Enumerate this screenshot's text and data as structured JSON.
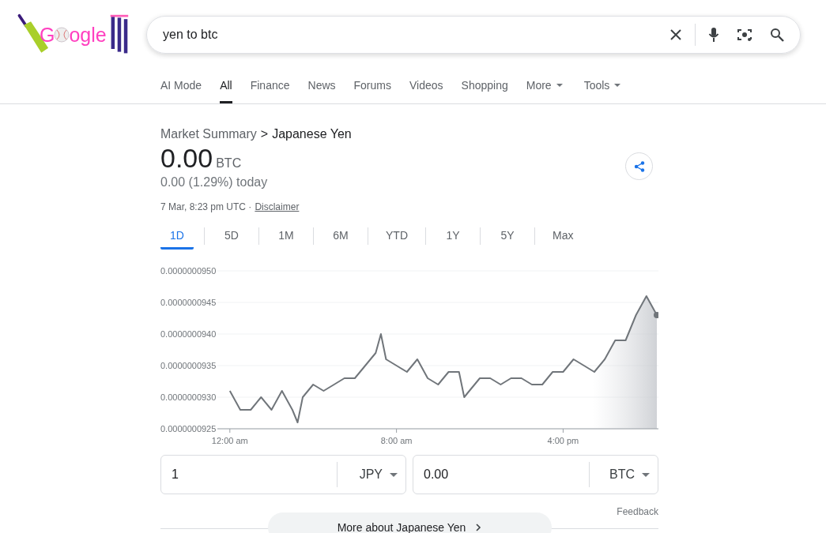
{
  "logo": {
    "lead": "G",
    "tail": "ogle"
  },
  "search": {
    "value": "yen to btc"
  },
  "tabs": [
    {
      "label": "AI Mode",
      "selected": false,
      "dropdown": false
    },
    {
      "label": "All",
      "selected": true,
      "dropdown": false
    },
    {
      "label": "Finance",
      "selected": false,
      "dropdown": false
    },
    {
      "label": "News",
      "selected": false,
      "dropdown": false
    },
    {
      "label": "Forums",
      "selected": false,
      "dropdown": false
    },
    {
      "label": "Videos",
      "selected": false,
      "dropdown": false
    },
    {
      "label": "Shopping",
      "selected": false,
      "dropdown": false
    },
    {
      "label": "More",
      "selected": false,
      "dropdown": true
    },
    {
      "label": "Tools",
      "selected": false,
      "dropdown": true
    }
  ],
  "summary": {
    "breadcrumb_root": "Market Summary",
    "breadcrumb_sep": ">",
    "breadcrumb_current": "Japanese Yen",
    "price": "0.00",
    "currency": "BTC",
    "change": "0.00 (1.29%) today",
    "timestamp": "7 Mar, 8:23 pm UTC ·",
    "disclaimer": "Disclaimer"
  },
  "ranges": [
    {
      "label": "1D",
      "selected": true
    },
    {
      "label": "5D",
      "selected": false
    },
    {
      "label": "1M",
      "selected": false
    },
    {
      "label": "6M",
      "selected": false
    },
    {
      "label": "YTD",
      "selected": false
    },
    {
      "label": "1Y",
      "selected": false
    },
    {
      "label": "5Y",
      "selected": false
    },
    {
      "label": "Max",
      "selected": false
    }
  ],
  "chart_data": {
    "type": "area",
    "grid": true,
    "xlim": [
      -0.6,
      20.5
    ],
    "x": [
      0,
      0.5,
      1,
      1.5,
      2,
      2.5,
      3,
      3.25,
      3.5,
      4,
      4.5,
      5,
      5.5,
      6,
      6.5,
      7,
      7.25,
      7.5,
      8,
      8.5,
      9,
      9.5,
      10,
      10.5,
      11,
      11.25,
      11.5,
      12,
      12.5,
      13,
      13.5,
      14,
      14.5,
      15,
      15.5,
      16,
      16.5,
      17,
      17.5,
      18,
      18.5,
      19,
      19.5,
      20,
      20.5
    ],
    "series": [
      {
        "color": "#70757a",
        "values": [
          9.31e-08,
          9.28e-08,
          9.28e-08,
          9.3e-08,
          9.28e-08,
          9.31e-08,
          9.28e-08,
          9.26e-08,
          9.3e-08,
          9.32e-08,
          9.31e-08,
          9.32e-08,
          9.33e-08,
          9.33e-08,
          9.35e-08,
          9.37e-08,
          9.4e-08,
          9.36e-08,
          9.35e-08,
          9.34e-08,
          9.36e-08,
          9.33e-08,
          9.32e-08,
          9.34e-08,
          9.34e-08,
          9.3e-08,
          9.31e-08,
          9.33e-08,
          9.33e-08,
          9.32e-08,
          9.33e-08,
          9.33e-08,
          9.32e-08,
          9.32e-08,
          9.34e-08,
          9.34e-08,
          9.36e-08,
          9.35e-08,
          9.34e-08,
          9.36e-08,
          9.39e-08,
          9.39e-08,
          9.43e-08,
          9.46e-08,
          9.43e-08
        ]
      }
    ],
    "ylim": [
      9.25e-08,
      9.5e-08
    ],
    "yticks": [
      {
        "value": 9.5e-08,
        "label": "0.0000000950"
      },
      {
        "value": 9.45e-08,
        "label": "0.0000000945"
      },
      {
        "value": 9.4e-08,
        "label": "0.0000000940"
      },
      {
        "value": 9.35e-08,
        "label": "0.0000000935"
      },
      {
        "value": 9.3e-08,
        "label": "0.0000000930"
      },
      {
        "value": 9.25e-08,
        "label": "0.0000000925"
      }
    ],
    "xticks": [
      {
        "value": 0,
        "label": "12:00 am"
      },
      {
        "value": 8,
        "label": "8:00 am"
      },
      {
        "value": 16,
        "label": "4:00 pm"
      }
    ]
  },
  "converter": [
    {
      "amount": "1",
      "currency": "JPY"
    },
    {
      "amount": "0.00",
      "currency": "BTC"
    }
  ],
  "feedback": "Feedback",
  "more_button": "More about Japanese Yen"
}
